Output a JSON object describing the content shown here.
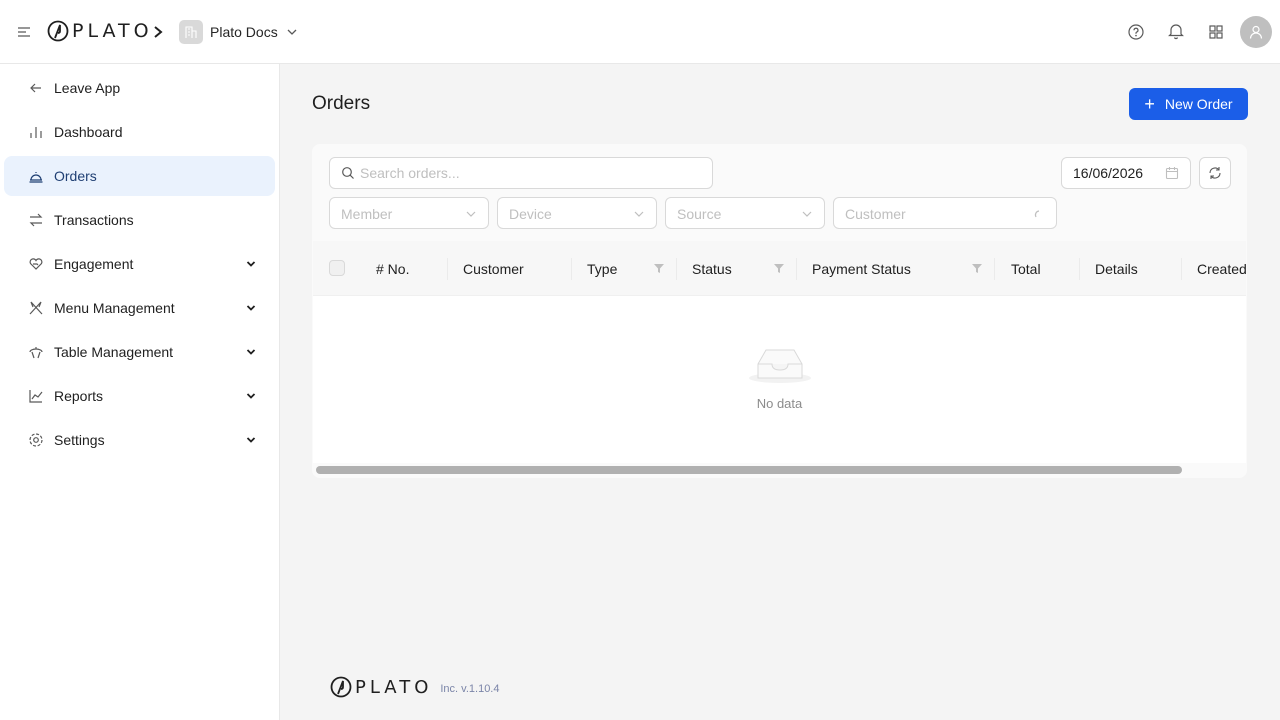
{
  "header": {
    "brand": "PLATO",
    "project_name": "Plato Docs"
  },
  "sidebar": {
    "items": [
      {
        "label": "Leave App",
        "icon": "arrow-left-icon"
      },
      {
        "label": "Dashboard",
        "icon": "bar-chart-icon"
      },
      {
        "label": "Orders",
        "icon": "cloche-icon",
        "active": true
      },
      {
        "label": "Transactions",
        "icon": "swap-icon"
      },
      {
        "label": "Engagement",
        "icon": "heart-hand-icon",
        "expandable": true
      },
      {
        "label": "Menu Management",
        "icon": "utensils-icon",
        "expandable": true
      },
      {
        "label": "Table Management",
        "icon": "table-icon",
        "expandable": true
      },
      {
        "label": "Reports",
        "icon": "line-chart-icon",
        "expandable": true
      },
      {
        "label": "Settings",
        "icon": "gear-icon",
        "expandable": true
      }
    ]
  },
  "main": {
    "title": "Orders",
    "new_button_label": "New Order",
    "search_placeholder": "Search orders...",
    "date_value": "16/06/2026",
    "filters": {
      "member": "Member",
      "device": "Device",
      "source": "Source",
      "customer": "Customer"
    },
    "columns": [
      "# No.",
      "Customer",
      "Type",
      "Status",
      "Payment Status",
      "Total",
      "Details",
      "Created"
    ],
    "empty_text": "No data"
  },
  "footer": {
    "brand": "PLATO",
    "version": "Inc. v.1.10.4"
  },
  "colors": {
    "primary": "#1b5ee8",
    "active_bg": "#eaf2fd"
  }
}
